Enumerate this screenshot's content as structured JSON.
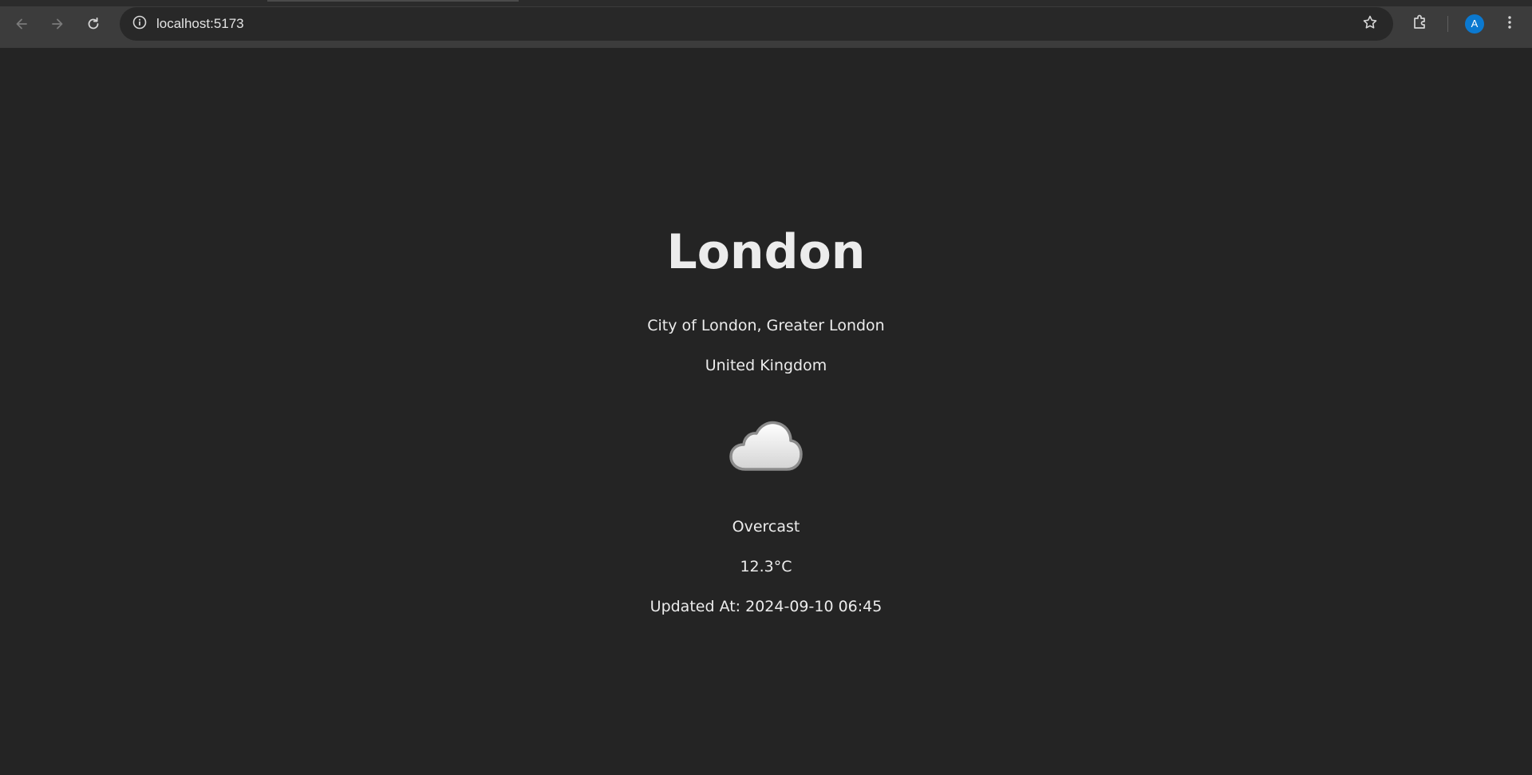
{
  "browser": {
    "url": "localhost:5173",
    "avatar_initial": "A",
    "icons": {
      "back": "arrow-left-icon",
      "forward": "arrow-right-icon",
      "reload": "reload-icon",
      "site_info": "info-icon",
      "bookmark": "star-icon",
      "extensions": "puzzle-icon",
      "menu": "kebab-menu-icon"
    }
  },
  "weather": {
    "city": "London",
    "region": "City of London, Greater London",
    "country": "United Kingdom",
    "icon": "cloud-icon",
    "condition": "Overcast",
    "temperature": "12.3°C",
    "updated": "Updated At: 2024-09-10 06:45"
  },
  "colors": {
    "page_background": "#242424",
    "toolbar_background": "#3c3c3c",
    "omnibox_background": "#282828",
    "text": "#ececec",
    "avatar": "#0b79d0"
  }
}
